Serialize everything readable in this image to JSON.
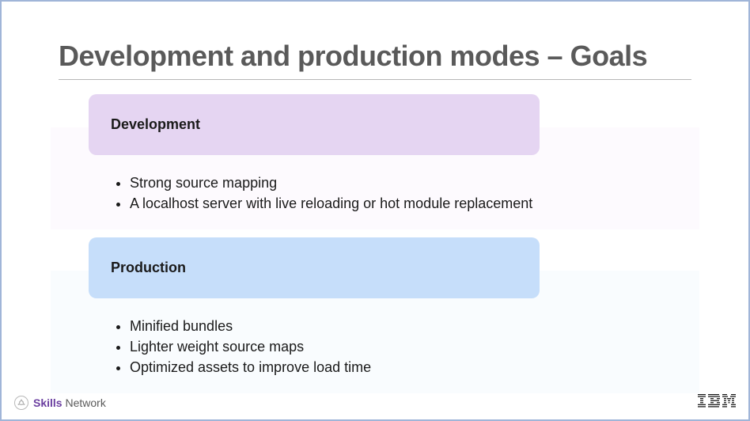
{
  "title": "Development and production modes – Goals",
  "sections": [
    {
      "heading": "Development",
      "bullets": [
        "Strong source mapping",
        "A localhost server with live reloading or hot module replacement"
      ]
    },
    {
      "heading": "Production",
      "bullets": [
        "Minified bundles",
        "Lighter weight source maps",
        "Optimized assets to improve load time"
      ]
    }
  ],
  "footer": {
    "skills_bold": "Skills",
    "skills_normal": " Network",
    "ibm": "IBM"
  }
}
